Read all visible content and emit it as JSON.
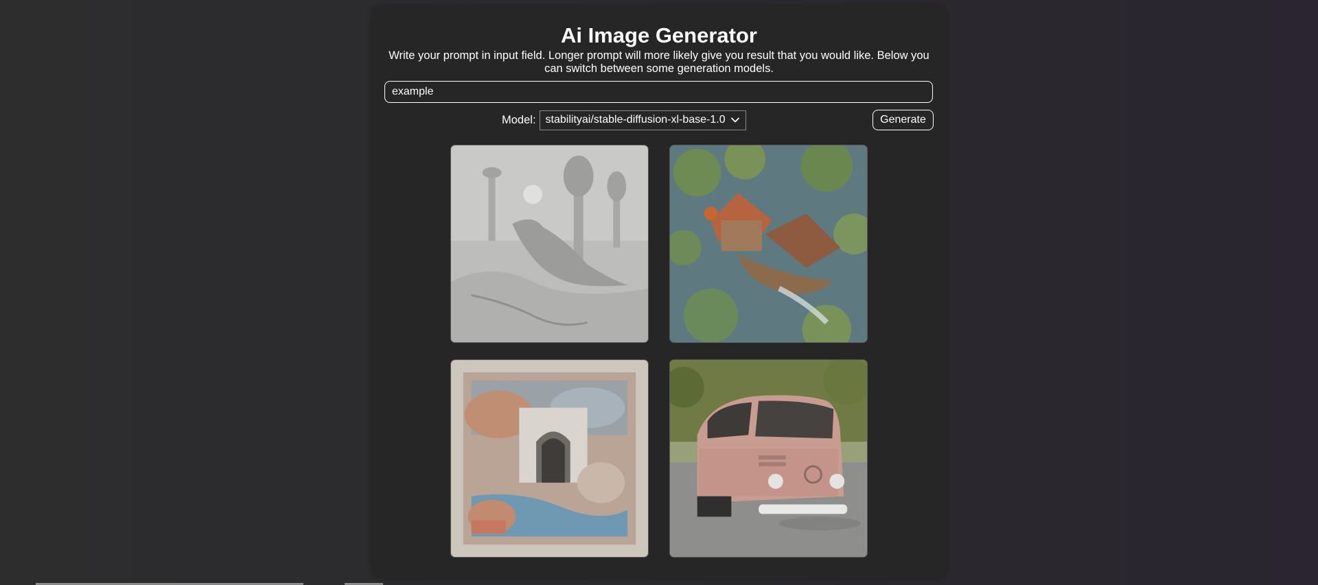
{
  "app": {
    "title": "Ai Image Generator",
    "description": "Write your prompt in input field. Longer prompt will more likely give you result that you would like. Below you can switch between some generation models."
  },
  "prompt": {
    "value": "example",
    "placeholder": "example"
  },
  "model": {
    "label": "Model:",
    "selected": "stabilityai/stable-diffusion-xl-base-1.0",
    "icon": "chevron-down-icon"
  },
  "actions": {
    "generate_label": "Generate"
  },
  "gallery": {
    "images": [
      {
        "alt": "Grey sketch of a bird with towers"
      },
      {
        "alt": "Aerial view of houses among trees"
      },
      {
        "alt": "Abstract painting with an arch"
      },
      {
        "alt": "Pink van on a road"
      }
    ]
  },
  "colors": {
    "background": "#2c2b2e",
    "card": "#262626",
    "text": "#ffffff",
    "border": "#ffffff"
  }
}
